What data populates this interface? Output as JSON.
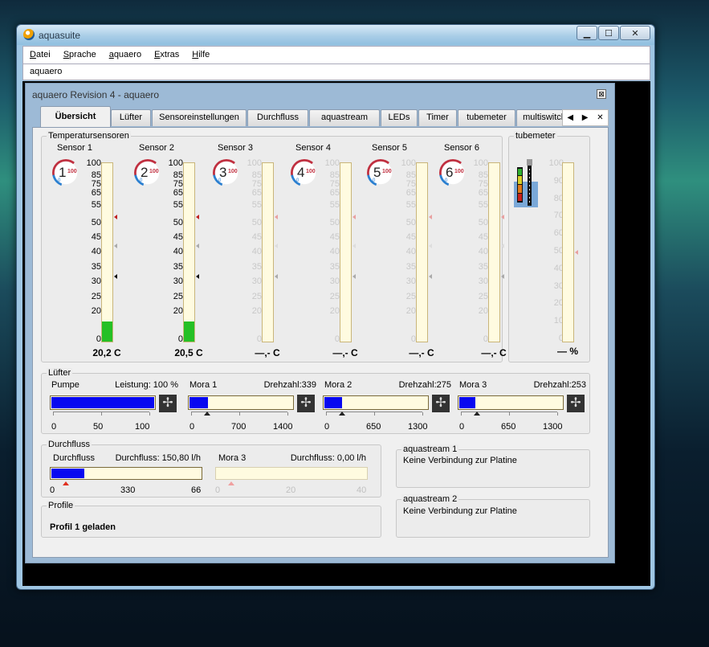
{
  "window": {
    "title": "aquasuite",
    "minimize": "▁",
    "maximize": "☐",
    "close": "✕"
  },
  "menu": {
    "items": [
      {
        "label": "Datei",
        "key": "D"
      },
      {
        "label": "Sprache",
        "key": "S"
      },
      {
        "label": "aquaero",
        "key": "a"
      },
      {
        "label": "Extras",
        "key": "E"
      },
      {
        "label": "Hilfe",
        "key": "H"
      }
    ]
  },
  "subtitle": "aquaero",
  "child": {
    "title": "aquaero Revision 4 -  aquaero",
    "close": "⊠"
  },
  "tabs": [
    "Übersicht",
    "Lüfter",
    "Sensoreinstellungen",
    "Durchfluss",
    "aquastream",
    "LEDs",
    "Timer",
    "tubemeter",
    "multiswitch"
  ],
  "tab_nav": {
    "prev": "◀",
    "next": "▶",
    "close": "✕"
  },
  "temp": {
    "group_title": "Temperatursensoren",
    "scale": [
      "100",
      "85",
      "75",
      "65",
      "55",
      "50",
      "45",
      "40",
      "35",
      "30",
      "25",
      "20",
      "0"
    ],
    "sensors": [
      {
        "label": "Sensor 1",
        "num": "1",
        "value": "20,2 C",
        "fill": 20.2,
        "active": true
      },
      {
        "label": "Sensor 2",
        "num": "2",
        "value": "20,5 C",
        "fill": 20.5,
        "active": true
      },
      {
        "label": "Sensor 3",
        "num": "3",
        "value": "—,- C",
        "fill": 0,
        "active": false
      },
      {
        "label": "Sensor 4",
        "num": "4",
        "value": "—,- C",
        "fill": 0,
        "active": false
      },
      {
        "label": "Sensor 5",
        "num": "5",
        "value": "—,- C",
        "fill": 0,
        "active": false
      },
      {
        "label": "Sensor 6",
        "num": "6",
        "value": "—,- C",
        "fill": 0,
        "active": false
      }
    ],
    "gauge_max": "100",
    "gauge_min": "0"
  },
  "tubemeter": {
    "group_title": "tubemeter",
    "scale": [
      "100",
      "90",
      "80",
      "70",
      "60",
      "50",
      "40",
      "30",
      "20",
      "10",
      "0"
    ],
    "value": "— %"
  },
  "fans": {
    "group_title": "Lüfter",
    "items": [
      {
        "name": "Pumpe",
        "metric": "Leistung: 100 %",
        "fill_pct": 100,
        "axis": [
          "0",
          "50",
          "100"
        ]
      },
      {
        "name": "Mora 1",
        "metric": "Drehzahl:339",
        "fill_pct": 18,
        "axis": [
          "0",
          "700",
          "1400"
        ]
      },
      {
        "name": "Mora 2",
        "metric": "Drehzahl:275",
        "fill_pct": 17,
        "axis": [
          "0",
          "650",
          "1300"
        ]
      },
      {
        "name": "Mora 3",
        "metric": "Drehzahl:253",
        "fill_pct": 16,
        "axis": [
          "0",
          "650",
          "1300"
        ]
      }
    ]
  },
  "flow": {
    "group_title": "Durchfluss",
    "items": [
      {
        "name": "Durchfluss",
        "metric": "Durchfluss: 150,80 l/h",
        "fill_pct": 22,
        "axis": [
          "0",
          "330",
          "66"
        ],
        "active": true
      },
      {
        "name": "Mora 3",
        "metric": "Durchfluss: 0,00 l/h",
        "fill_pct": 0,
        "axis": [
          "0",
          "20",
          "40"
        ],
        "active": false
      }
    ]
  },
  "profile": {
    "group_title": "Profile",
    "text": "Profil  1 geladen"
  },
  "aquastream1": {
    "group_title": "aquastream 1",
    "text": "Keine Verbindung zur Platine"
  },
  "aquastream2": {
    "group_title": "aquastream 2",
    "text": "Keine Verbindung zur Platine"
  },
  "colors": {
    "fan_fill": "#0808f0",
    "temp_fill": "#25c025",
    "bar_bg": "#fffbe0",
    "gauge_red": "#c03040",
    "gauge_blue": "#2a7fd0"
  }
}
